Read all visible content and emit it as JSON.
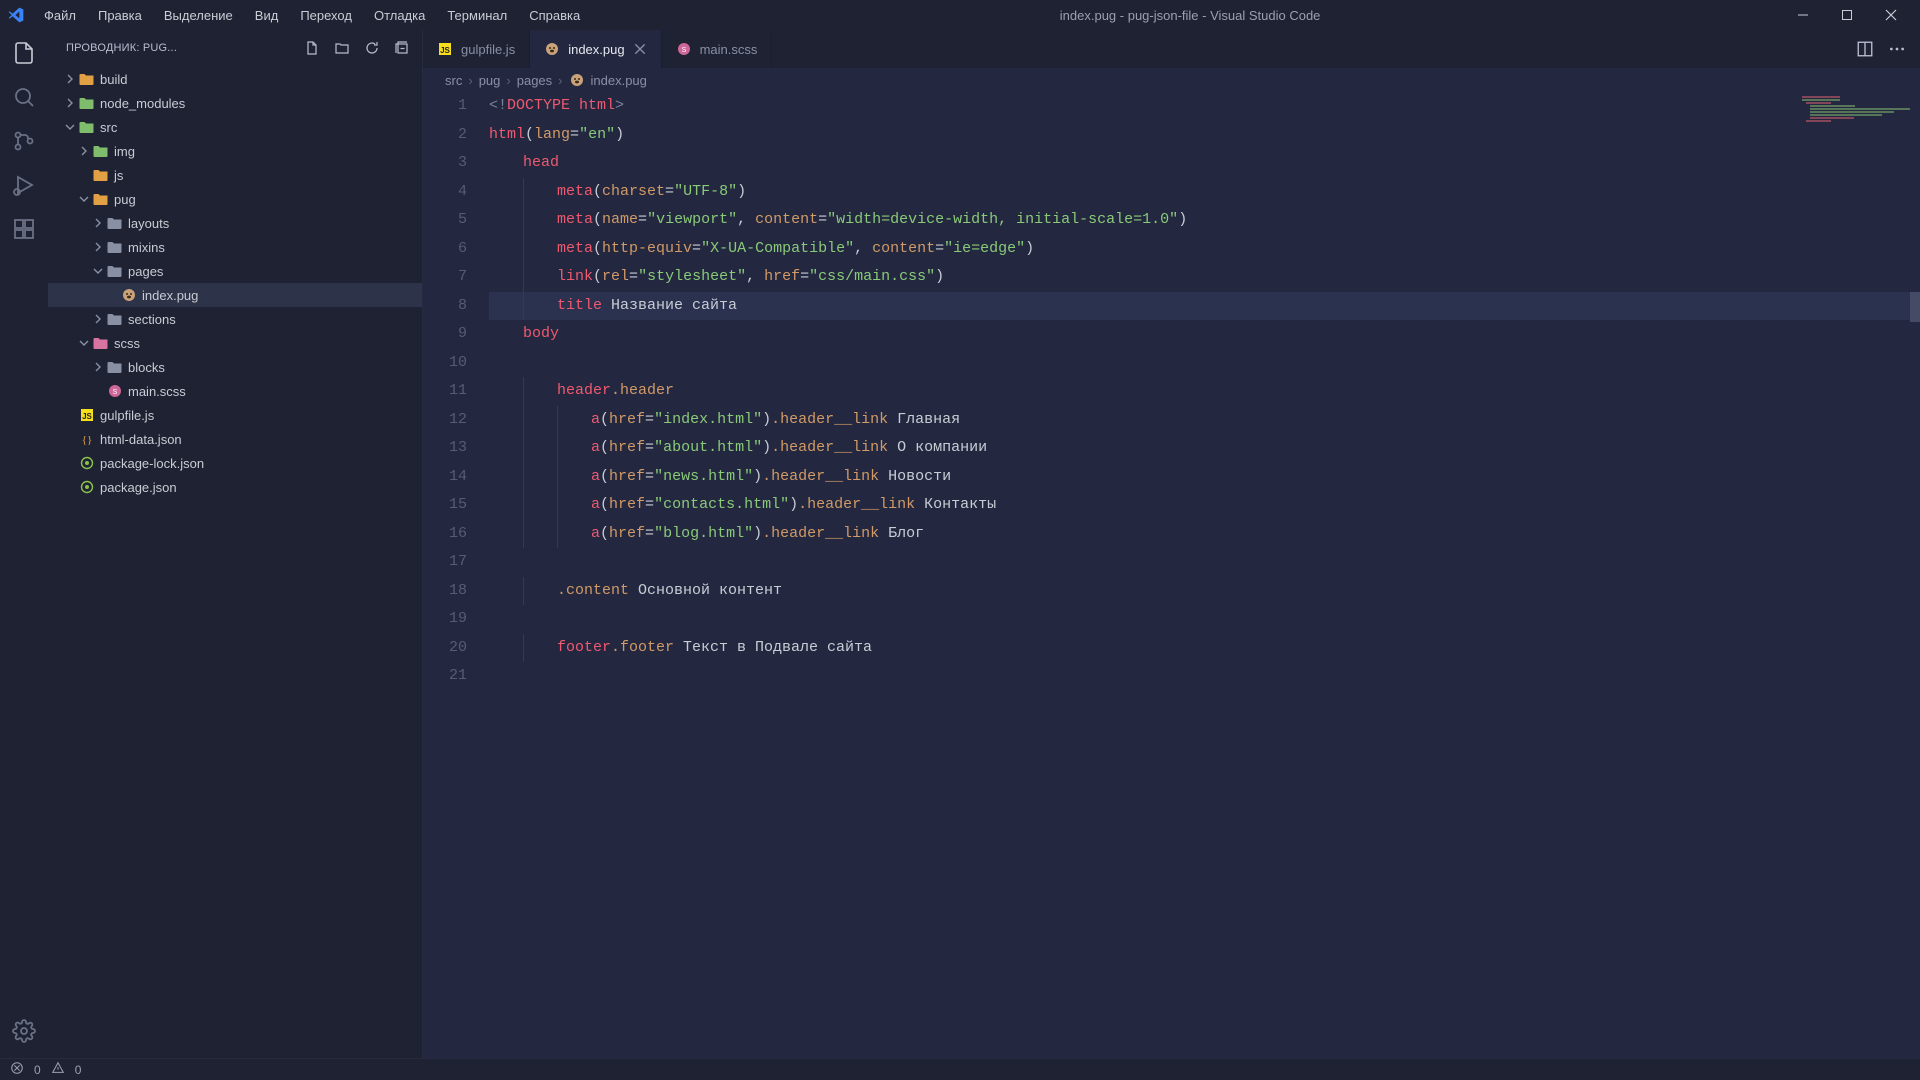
{
  "window": {
    "title": "index.pug - pug-json-file - Visual Studio Code"
  },
  "menu": {
    "items": [
      "Файл",
      "Правка",
      "Выделение",
      "Вид",
      "Переход",
      "Отладка",
      "Терминал",
      "Справка"
    ]
  },
  "sidebar": {
    "title": "ПРОВОДНИК: PUG...",
    "tree": [
      {
        "name": "build",
        "depth": 0,
        "expandable": true,
        "expanded": false,
        "icon": "folder-orange"
      },
      {
        "name": "node_modules",
        "depth": 0,
        "expandable": true,
        "expanded": false,
        "icon": "folder-green"
      },
      {
        "name": "src",
        "depth": 0,
        "expandable": true,
        "expanded": true,
        "icon": "folder-green"
      },
      {
        "name": "img",
        "depth": 1,
        "expandable": true,
        "expanded": false,
        "icon": "folder-green"
      },
      {
        "name": "js",
        "depth": 1,
        "expandable": false,
        "expanded": false,
        "icon": "folder-orange"
      },
      {
        "name": "pug",
        "depth": 1,
        "expandable": true,
        "expanded": true,
        "icon": "folder-orange"
      },
      {
        "name": "layouts",
        "depth": 2,
        "expandable": true,
        "expanded": false,
        "icon": "folder-grey"
      },
      {
        "name": "mixins",
        "depth": 2,
        "expandable": true,
        "expanded": false,
        "icon": "folder-grey"
      },
      {
        "name": "pages",
        "depth": 2,
        "expandable": true,
        "expanded": true,
        "icon": "folder-grey"
      },
      {
        "name": "index.pug",
        "depth": 3,
        "expandable": false,
        "expanded": false,
        "icon": "pug",
        "selected": true
      },
      {
        "name": "sections",
        "depth": 2,
        "expandable": true,
        "expanded": false,
        "icon": "folder-grey"
      },
      {
        "name": "scss",
        "depth": 1,
        "expandable": true,
        "expanded": true,
        "icon": "folder-pink"
      },
      {
        "name": "blocks",
        "depth": 2,
        "expandable": true,
        "expanded": false,
        "icon": "folder-grey"
      },
      {
        "name": "main.scss",
        "depth": 2,
        "expandable": false,
        "expanded": false,
        "icon": "scss"
      },
      {
        "name": "gulpfile.js",
        "depth": 0,
        "expandable": false,
        "expanded": false,
        "icon": "js"
      },
      {
        "name": "html-data.json",
        "depth": 0,
        "expandable": false,
        "expanded": false,
        "icon": "json"
      },
      {
        "name": "package-lock.json",
        "depth": 0,
        "expandable": false,
        "expanded": false,
        "icon": "npm"
      },
      {
        "name": "package.json",
        "depth": 0,
        "expandable": false,
        "expanded": false,
        "icon": "npm"
      }
    ]
  },
  "tabs": [
    {
      "label": "gulpfile.js",
      "icon": "js",
      "active": false
    },
    {
      "label": "index.pug",
      "icon": "pug",
      "active": true
    },
    {
      "label": "main.scss",
      "icon": "scss",
      "active": false
    }
  ],
  "breadcrumbs": [
    "src",
    "pug",
    "pages",
    "index.pug"
  ],
  "code": {
    "currentLine": 8,
    "lines": [
      {
        "n": 1,
        "indent": 0,
        "segs": [
          {
            "t": "<!",
            "c": "gray"
          },
          {
            "t": "DOCTYPE html",
            "c": "tag"
          },
          {
            "t": ">",
            "c": "gray"
          }
        ]
      },
      {
        "n": 2,
        "indent": 0,
        "segs": [
          {
            "t": "html",
            "c": "tag"
          },
          {
            "t": "(",
            "c": "punc"
          },
          {
            "t": "lang",
            "c": "attr"
          },
          {
            "t": "=",
            "c": "punc"
          },
          {
            "t": "\"en\"",
            "c": "str"
          },
          {
            "t": ")",
            "c": "punc"
          }
        ]
      },
      {
        "n": 3,
        "indent": 1,
        "segs": [
          {
            "t": "head",
            "c": "tag"
          }
        ]
      },
      {
        "n": 4,
        "indent": 2,
        "segs": [
          {
            "t": "meta",
            "c": "tag"
          },
          {
            "t": "(",
            "c": "punc"
          },
          {
            "t": "charset",
            "c": "attr"
          },
          {
            "t": "=",
            "c": "punc"
          },
          {
            "t": "\"UTF-8\"",
            "c": "str"
          },
          {
            "t": ")",
            "c": "punc"
          }
        ]
      },
      {
        "n": 5,
        "indent": 2,
        "segs": [
          {
            "t": "meta",
            "c": "tag"
          },
          {
            "t": "(",
            "c": "punc"
          },
          {
            "t": "name",
            "c": "attr"
          },
          {
            "t": "=",
            "c": "punc"
          },
          {
            "t": "\"viewport\"",
            "c": "str"
          },
          {
            "t": ", ",
            "c": "punc"
          },
          {
            "t": "content",
            "c": "attr"
          },
          {
            "t": "=",
            "c": "punc"
          },
          {
            "t": "\"width=device-width, initial-scale=1.0\"",
            "c": "str"
          },
          {
            "t": ")",
            "c": "punc"
          }
        ]
      },
      {
        "n": 6,
        "indent": 2,
        "segs": [
          {
            "t": "meta",
            "c": "tag"
          },
          {
            "t": "(",
            "c": "punc"
          },
          {
            "t": "http-equiv",
            "c": "attr"
          },
          {
            "t": "=",
            "c": "punc"
          },
          {
            "t": "\"X-UA-Compatible\"",
            "c": "str"
          },
          {
            "t": ", ",
            "c": "punc"
          },
          {
            "t": "content",
            "c": "attr"
          },
          {
            "t": "=",
            "c": "punc"
          },
          {
            "t": "\"ie=edge\"",
            "c": "str"
          },
          {
            "t": ")",
            "c": "punc"
          }
        ]
      },
      {
        "n": 7,
        "indent": 2,
        "segs": [
          {
            "t": "link",
            "c": "tag"
          },
          {
            "t": "(",
            "c": "punc"
          },
          {
            "t": "rel",
            "c": "attr"
          },
          {
            "t": "=",
            "c": "punc"
          },
          {
            "t": "\"stylesheet\"",
            "c": "str"
          },
          {
            "t": ", ",
            "c": "punc"
          },
          {
            "t": "href",
            "c": "attr"
          },
          {
            "t": "=",
            "c": "punc"
          },
          {
            "t": "\"css/main.css\"",
            "c": "str"
          },
          {
            "t": ")",
            "c": "punc"
          }
        ]
      },
      {
        "n": 8,
        "indent": 2,
        "segs": [
          {
            "t": "title",
            "c": "tag"
          },
          {
            "t": " Название сайта",
            "c": "text"
          }
        ]
      },
      {
        "n": 9,
        "indent": 1,
        "segs": [
          {
            "t": "body",
            "c": "tag"
          }
        ]
      },
      {
        "n": 10,
        "indent": 0,
        "segs": []
      },
      {
        "n": 11,
        "indent": 2,
        "segs": [
          {
            "t": "header",
            "c": "tag"
          },
          {
            "t": ".header",
            "c": "class"
          }
        ]
      },
      {
        "n": 12,
        "indent": 3,
        "segs": [
          {
            "t": "a",
            "c": "tag"
          },
          {
            "t": "(",
            "c": "punc"
          },
          {
            "t": "href",
            "c": "attr"
          },
          {
            "t": "=",
            "c": "punc"
          },
          {
            "t": "\"index.html\"",
            "c": "str"
          },
          {
            "t": ")",
            "c": "punc"
          },
          {
            "t": ".header__link",
            "c": "class"
          },
          {
            "t": " Главная",
            "c": "text"
          }
        ]
      },
      {
        "n": 13,
        "indent": 3,
        "segs": [
          {
            "t": "a",
            "c": "tag"
          },
          {
            "t": "(",
            "c": "punc"
          },
          {
            "t": "href",
            "c": "attr"
          },
          {
            "t": "=",
            "c": "punc"
          },
          {
            "t": "\"about.html\"",
            "c": "str"
          },
          {
            "t": ")",
            "c": "punc"
          },
          {
            "t": ".header__link",
            "c": "class"
          },
          {
            "t": " О компании",
            "c": "text"
          }
        ]
      },
      {
        "n": 14,
        "indent": 3,
        "segs": [
          {
            "t": "a",
            "c": "tag"
          },
          {
            "t": "(",
            "c": "punc"
          },
          {
            "t": "href",
            "c": "attr"
          },
          {
            "t": "=",
            "c": "punc"
          },
          {
            "t": "\"news.html\"",
            "c": "str"
          },
          {
            "t": ")",
            "c": "punc"
          },
          {
            "t": ".header__link",
            "c": "class"
          },
          {
            "t": " Новости",
            "c": "text"
          }
        ]
      },
      {
        "n": 15,
        "indent": 3,
        "segs": [
          {
            "t": "a",
            "c": "tag"
          },
          {
            "t": "(",
            "c": "punc"
          },
          {
            "t": "href",
            "c": "attr"
          },
          {
            "t": "=",
            "c": "punc"
          },
          {
            "t": "\"contacts.html\"",
            "c": "str"
          },
          {
            "t": ")",
            "c": "punc"
          },
          {
            "t": ".header__link",
            "c": "class"
          },
          {
            "t": " Контакты",
            "c": "text"
          }
        ]
      },
      {
        "n": 16,
        "indent": 3,
        "segs": [
          {
            "t": "a",
            "c": "tag"
          },
          {
            "t": "(",
            "c": "punc"
          },
          {
            "t": "href",
            "c": "attr"
          },
          {
            "t": "=",
            "c": "punc"
          },
          {
            "t": "\"blog.html\"",
            "c": "str"
          },
          {
            "t": ")",
            "c": "punc"
          },
          {
            "t": ".header__link",
            "c": "class"
          },
          {
            "t": " Блог",
            "c": "text"
          }
        ]
      },
      {
        "n": 17,
        "indent": 0,
        "segs": []
      },
      {
        "n": 18,
        "indent": 2,
        "segs": [
          {
            "t": ".content",
            "c": "class"
          },
          {
            "t": " Основной контент",
            "c": "text"
          }
        ]
      },
      {
        "n": 19,
        "indent": 0,
        "segs": []
      },
      {
        "n": 20,
        "indent": 2,
        "segs": [
          {
            "t": "footer",
            "c": "tag"
          },
          {
            "t": ".footer",
            "c": "class"
          },
          {
            "t": " Текст в Подвале сайта",
            "c": "text"
          }
        ]
      },
      {
        "n": 21,
        "indent": 0,
        "segs": []
      }
    ]
  },
  "status": {
    "errors": "0",
    "warnings": "0"
  }
}
